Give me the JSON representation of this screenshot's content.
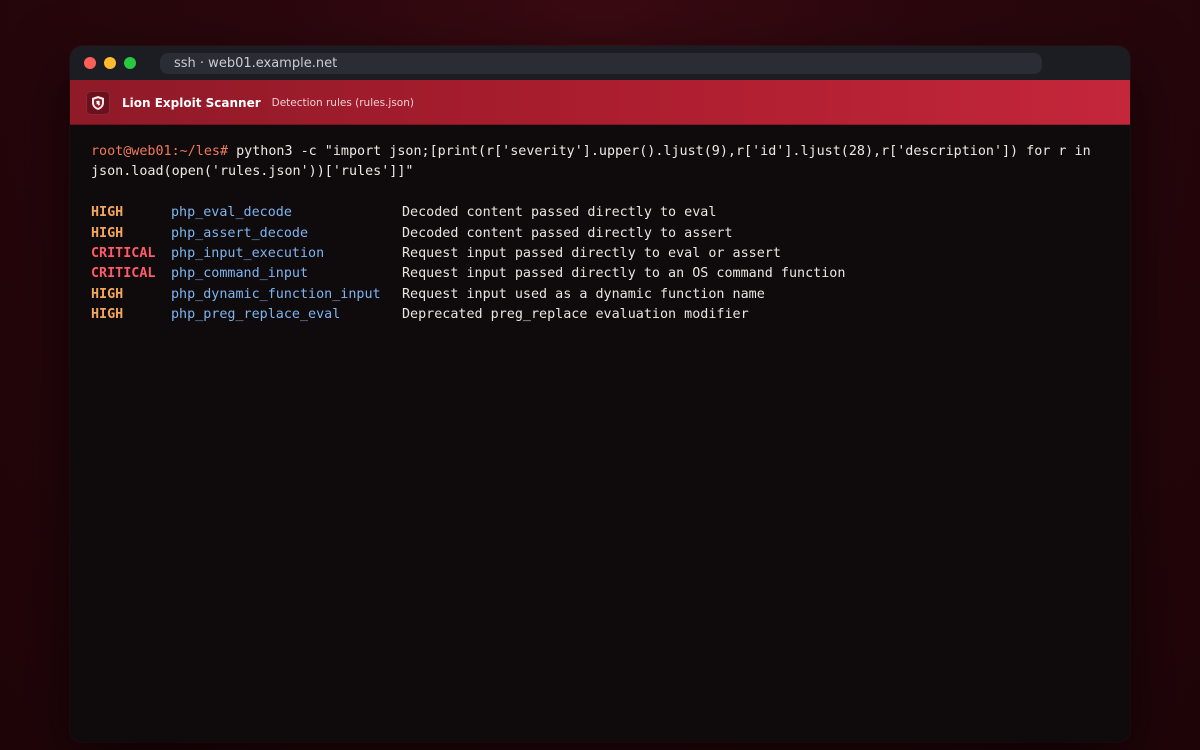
{
  "window": {
    "address": "ssh · web01.example.net"
  },
  "app": {
    "title": "Lion Exploit Scanner",
    "subtitle": "Detection rules (rules.json)",
    "logo_icon": "lion-shield-icon"
  },
  "terminal": {
    "prompt": "root@web01:~/les#",
    "command_line1": " python3 -c \"import json;[print(r['severity'].upper().ljust(9),r['id'].ljust(28),r['description']) for r in",
    "command_line2": "json.load(open('rules.json'))['rules']]\"",
    "rules": [
      {
        "severity": "HIGH",
        "id": "php_eval_decode",
        "description": "Decoded content passed directly to eval"
      },
      {
        "severity": "HIGH",
        "id": "php_assert_decode",
        "description": "Decoded content passed directly to assert"
      },
      {
        "severity": "CRITICAL",
        "id": "php_input_execution",
        "description": "Request input passed directly to eval or assert"
      },
      {
        "severity": "CRITICAL",
        "id": "php_command_input",
        "description": "Request input passed directly to an OS command function"
      },
      {
        "severity": "HIGH",
        "id": "php_dynamic_function_input",
        "description": "Request input used as a dynamic function name"
      },
      {
        "severity": "HIGH",
        "id": "php_preg_replace_eval",
        "description": "Deprecated preg_replace evaluation modifier"
      }
    ]
  },
  "colors": {
    "high": "#f4a65a",
    "critical": "#ff5a6a",
    "rule_id": "#7db4f0",
    "prompt": "#f07a5a",
    "brand": "#a81d2e"
  }
}
